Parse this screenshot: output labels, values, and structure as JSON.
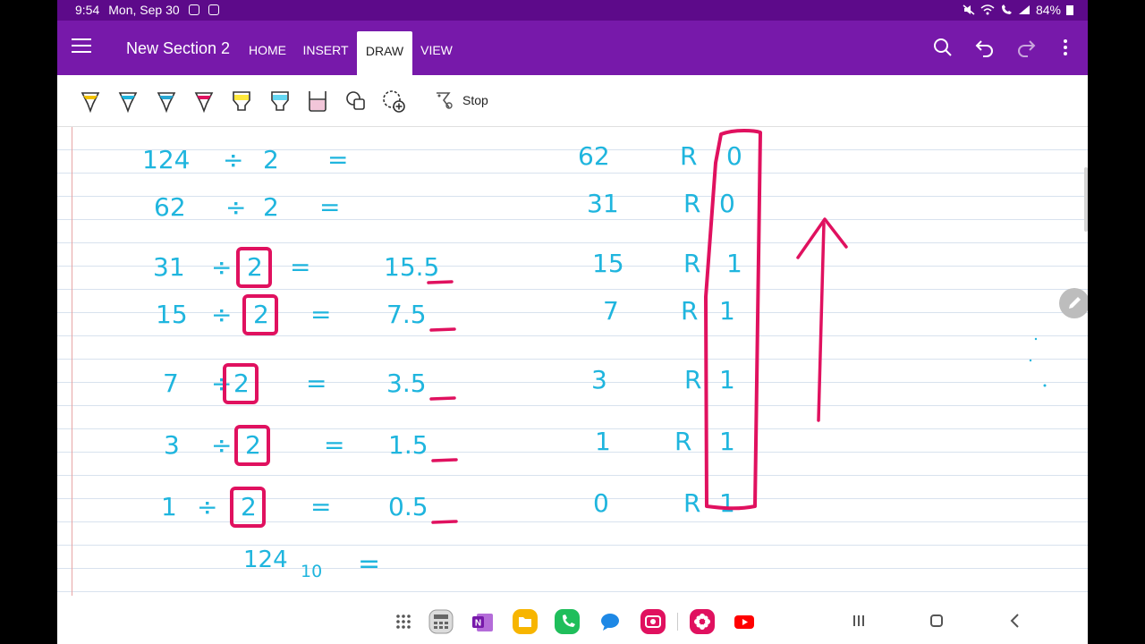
{
  "status_bar": {
    "time": "9:54",
    "date": "Mon, Sep 30",
    "battery": "84%"
  },
  "app": {
    "section_title": "New Section 2",
    "tabs": [
      {
        "label": "HOME",
        "active": false
      },
      {
        "label": "INSERT",
        "active": false
      },
      {
        "label": "DRAW",
        "active": true
      },
      {
        "label": "VIEW",
        "active": false
      }
    ],
    "actions": [
      "search-icon",
      "undo-icon",
      "redo-icon",
      "more-icon"
    ]
  },
  "ribbon": {
    "tools": [
      {
        "name": "pen-yellow",
        "color": "#f2c200"
      },
      {
        "name": "pen-cyan",
        "color": "#1fb5de",
        "selected": true
      },
      {
        "name": "pen-blue",
        "color": "#29a7d3"
      },
      {
        "name": "pen-magenta",
        "color": "#e0115f"
      },
      {
        "name": "highlighter-yellow",
        "color": "#ffe83b"
      },
      {
        "name": "highlighter-cyan",
        "color": "#63d6f2"
      },
      {
        "name": "highlighter-pink",
        "color": "#f2c6d9"
      },
      {
        "name": "shapes-icon"
      },
      {
        "name": "lasso-add-icon"
      }
    ],
    "stop_label": "Stop"
  },
  "notes": {
    "rows": [
      {
        "dividend": "124",
        "op": "÷",
        "divisor": "2",
        "eq": "=",
        "decimal": "",
        "quotient": "62",
        "r": "R",
        "remainder": "0"
      },
      {
        "dividend": "62",
        "op": "÷",
        "divisor": "2",
        "eq": "=",
        "decimal": "",
        "quotient": "31",
        "r": "R",
        "remainder": "0"
      },
      {
        "dividend": "31",
        "op": "÷",
        "divisor": "2",
        "eq": "=",
        "decimal": "15.5",
        "quotient": "15",
        "r": "R",
        "remainder": "1"
      },
      {
        "dividend": "15",
        "op": "÷",
        "divisor": "2",
        "eq": "=",
        "decimal": "7.5",
        "quotient": "7",
        "r": "R",
        "remainder": "1"
      },
      {
        "dividend": "7",
        "op": "÷",
        "divisor": "2",
        "eq": "=",
        "decimal": "3.5",
        "quotient": "3",
        "r": "R",
        "remainder": "1"
      },
      {
        "dividend": "3",
        "op": "÷",
        "divisor": "2",
        "eq": "=",
        "decimal": "1.5",
        "quotient": "1",
        "r": "R",
        "remainder": "1"
      },
      {
        "dividend": "1",
        "op": "÷",
        "divisor": "2",
        "eq": "=",
        "decimal": "0.5",
        "quotient": "0",
        "r": "R",
        "remainder": "1"
      }
    ],
    "result_base": "124",
    "result_sub": "10",
    "result_eq": "=",
    "ink_colors": {
      "cyan": "#1fb5de",
      "magenta": "#e0115f"
    }
  },
  "dock": {
    "apps": [
      {
        "name": "apps-grid-icon",
        "color": "#555555"
      },
      {
        "name": "calculator-app-icon",
        "color": "#8c8c8c"
      },
      {
        "name": "onenote-app-icon",
        "color": "#7719aa"
      },
      {
        "name": "files-app-icon",
        "color": "#f7b500"
      },
      {
        "name": "phone-app-icon",
        "color": "#1fbe5b"
      },
      {
        "name": "messages-app-icon",
        "color": "#1e88e5"
      },
      {
        "name": "camera-app-icon",
        "color": "#e0115f"
      },
      {
        "name": "bixby-app-icon",
        "color": "#e0115f"
      },
      {
        "name": "youtube-app-icon",
        "color": "#ff0000"
      }
    ]
  }
}
